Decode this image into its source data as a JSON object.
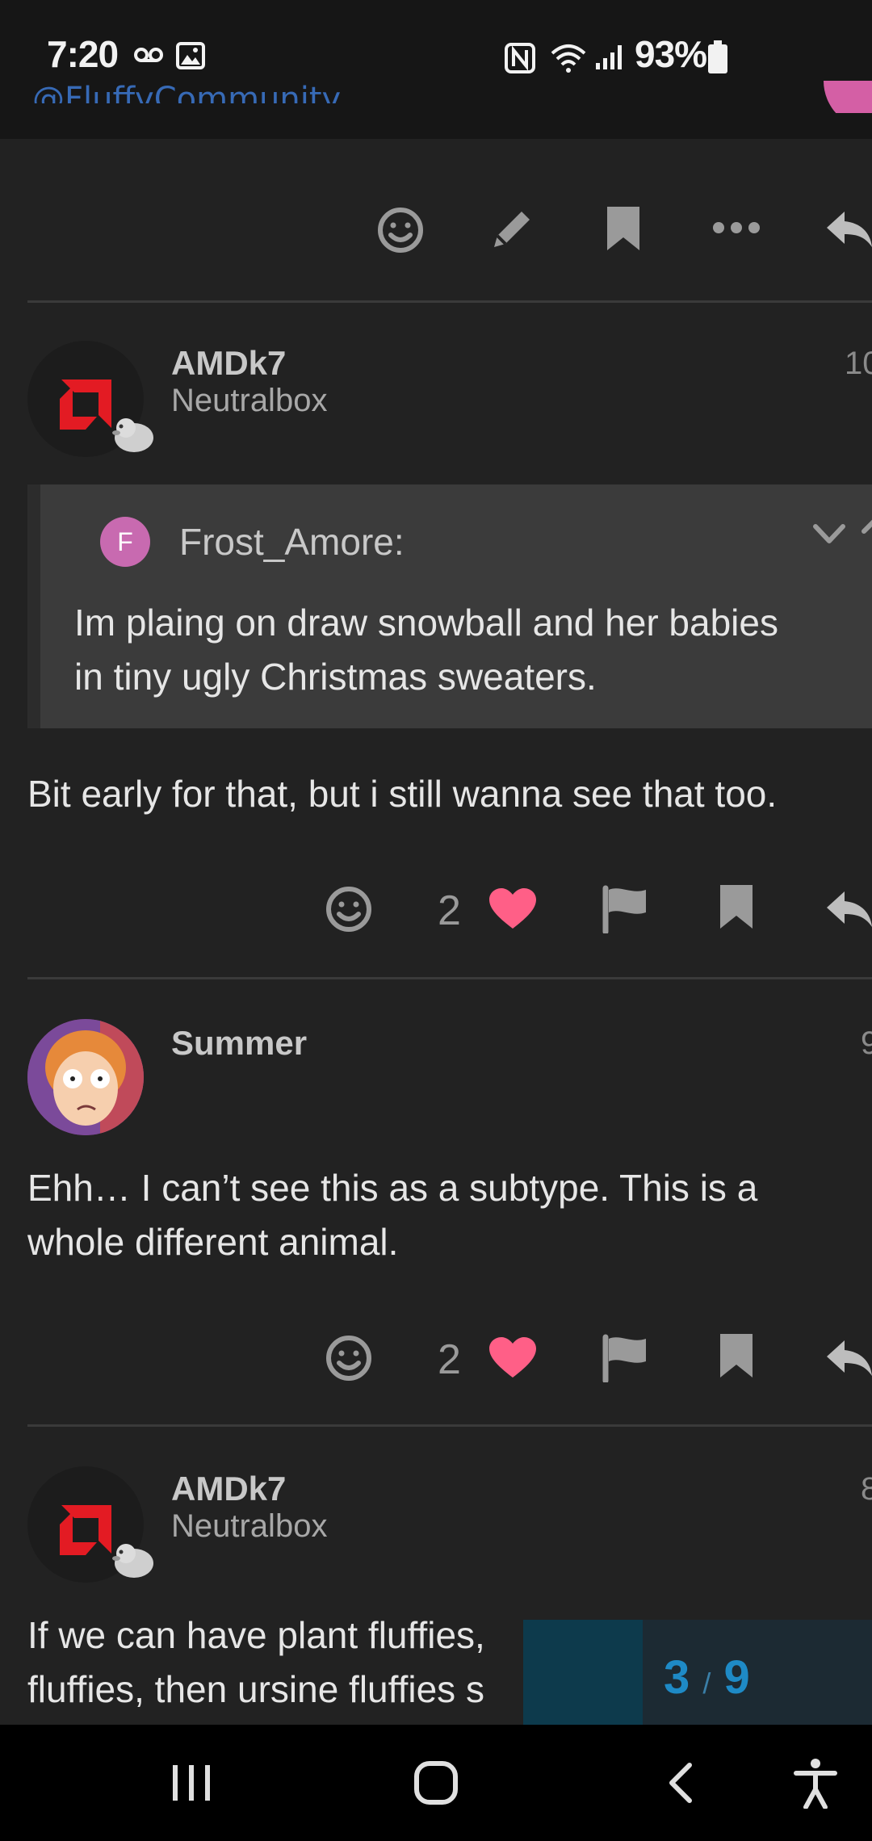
{
  "status_bar": {
    "time": "7:20",
    "battery": "93%"
  },
  "partial_header_text": "@FluffyCommunity",
  "posts": [
    {
      "username": "AMDk7",
      "user_title": "Neutralbox",
      "date": "10",
      "quote": {
        "avatar_letter": "F",
        "author": "Frost_Amore:",
        "lines": [
          "Im plaing on draw snowball and her babies",
          "in tiny ugly Christmas sweaters."
        ]
      },
      "body_lines": [
        "Bit early for that, but i still wanna see that too."
      ],
      "like_count": "2"
    },
    {
      "username": "Summer",
      "date": "9",
      "body_lines": [
        "Ehh… I can’t see this as a subtype. This is a",
        "whole different animal."
      ],
      "like_count": "2"
    },
    {
      "username": "AMDk7",
      "user_title": "Neutralbox",
      "date": "8",
      "body_lines": [
        "If we can have plant fluffies,",
        "fluffies, then ursine fluffies s"
      ]
    }
  ],
  "progress": {
    "current": "3",
    "separator": "/",
    "total": "9"
  },
  "colors": {
    "heart": "#ff5f87",
    "accent": "#1e8ac6",
    "background": "#222222"
  },
  "icons": [
    "smile-icon",
    "pencil-icon",
    "bookmark-icon",
    "more-icon",
    "reply-icon",
    "heart-icon",
    "flag-icon"
  ]
}
